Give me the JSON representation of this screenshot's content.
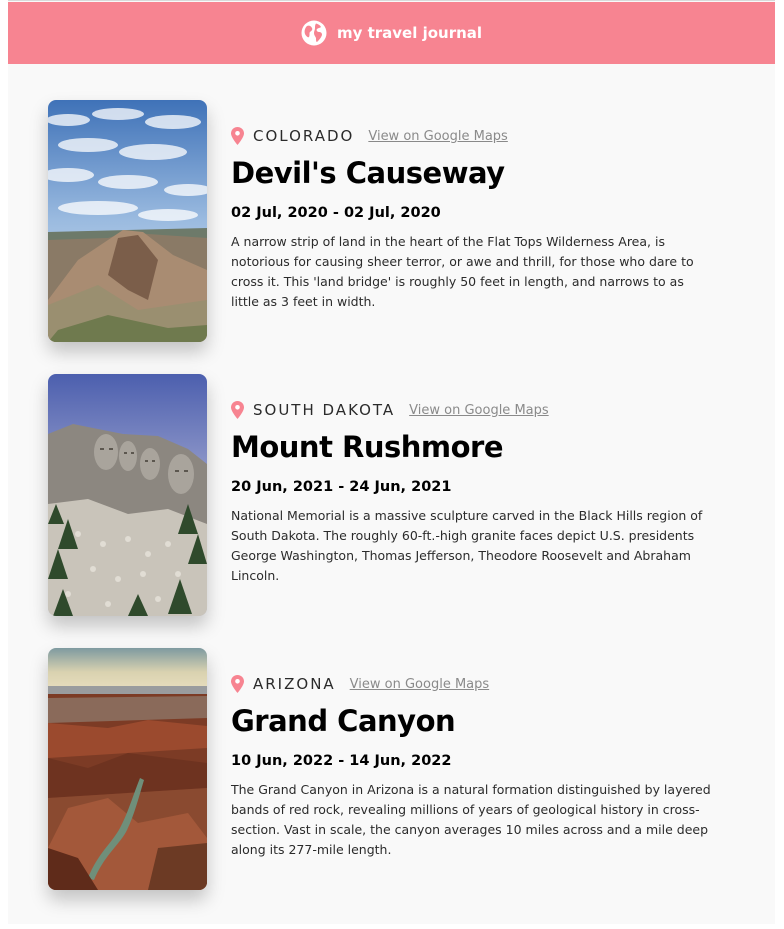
{
  "header": {
    "title": "my travel journal",
    "icon": "globe-icon",
    "background": "#f78491"
  },
  "link_label": "View on Google Maps",
  "entries": [
    {
      "location": "COLORADO",
      "place": "Devil's Causeway",
      "dates": "02 Jul, 2020 - 02 Jul, 2020",
      "description": "A narrow strip of land in the heart of the Flat Tops Wilderness Area, is notorious for causing sheer terror, or awe and thrill, for those who dare to cross it. This 'land bridge' is roughly 50 feet in length, and narrows to as little as 3 feet in width.",
      "image": "devils-causeway-photo"
    },
    {
      "location": "SOUTH DAKOTA",
      "place": "Mount Rushmore",
      "dates": "20 Jun, 2021 - 24 Jun, 2021",
      "description": "National Memorial is a massive sculpture carved in the Black Hills region of South Dakota. The roughly 60-ft.-high granite faces depict U.S. presidents George Washington, Thomas Jefferson, Theodore Roosevelt and Abraham Lincoln.",
      "image": "mount-rushmore-photo"
    },
    {
      "location": "ARIZONA",
      "place": "Grand Canyon",
      "dates": "10 Jun, 2022 - 14 Jun, 2022",
      "description": "The Grand Canyon in Arizona is a natural formation distinguished by layered bands of red rock, revealing millions of years of geological history in cross-section. Vast in scale, the canyon averages 10 miles across and a mile deep along its 277-mile length.",
      "image": "grand-canyon-photo"
    }
  ],
  "colors": {
    "accent": "#f78491",
    "page": "#f9f9f9",
    "link": "#8a8a8a"
  }
}
